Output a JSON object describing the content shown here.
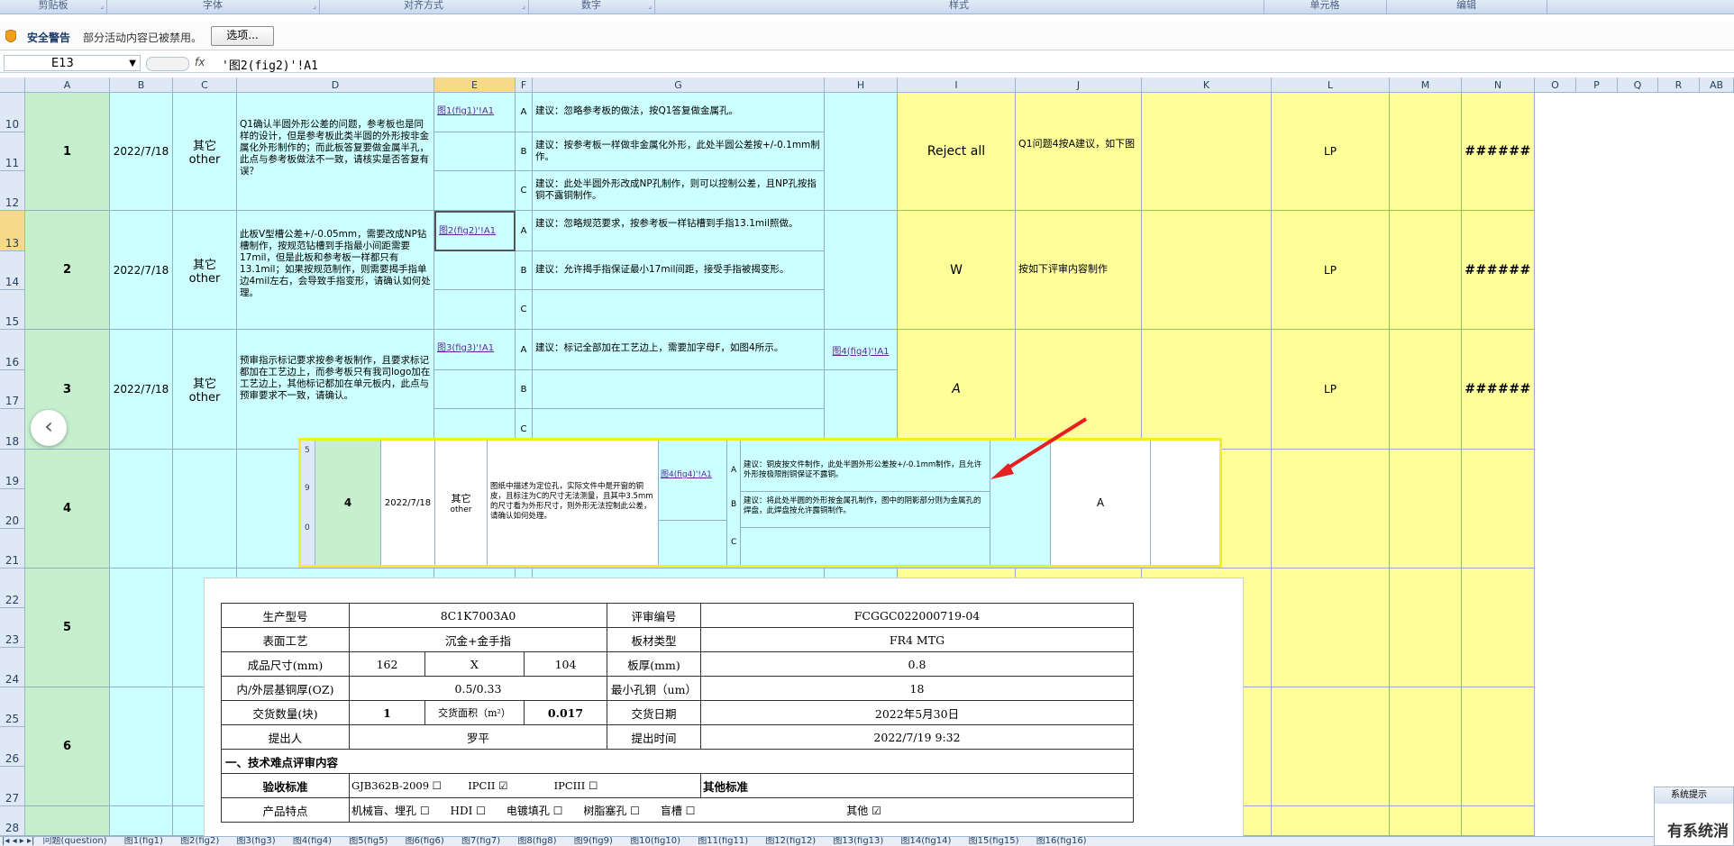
{
  "ribbon": {
    "groups": [
      "剪贴板",
      "字体",
      "对齐方式",
      "数字",
      "样式",
      "单元格",
      "编辑"
    ]
  },
  "security_bar": {
    "title": "安全警告",
    "message": "部分活动内容已被禁用。",
    "options_button": "选项..."
  },
  "formula_bar": {
    "name_box": "E13",
    "fx": "fx",
    "formula": "'图2(fig2)'!A1"
  },
  "columns": [
    "A",
    "B",
    "C",
    "D",
    "E",
    "F",
    "G",
    "H",
    "I",
    "J",
    "K",
    "L",
    "M",
    "N",
    "O",
    "P",
    "Q",
    "R",
    "AB"
  ],
  "rows": [
    "10",
    "11",
    "12",
    "13",
    "14",
    "15",
    "16",
    "17",
    "18",
    "19",
    "20",
    "21",
    "22",
    "23",
    "24",
    "25",
    "26",
    "27",
    "28"
  ],
  "records": [
    {
      "no": "1",
      "date": "2022/7/18",
      "type_cn": "其它",
      "type_en": "other",
      "question": "Q1确认半圆外形公差的问题，参考板也是同样的设计，但是参考板此类半圆的外形按非金属化外形制作的；而此板答复要做金属半孔，此点与参考板做法不一致，请核实是否答复有误？",
      "link": "图1(fig1)'!A1",
      "options": [
        {
          "letter": "A",
          "text": "建议：忽略参考板的做法，按Q1答复做金属孔。"
        },
        {
          "letter": "B",
          "text": "建议：按参考板一样做非金属化外形，此处半圆公差按+/-0.1mm制作。"
        },
        {
          "letter": "C",
          "text": "建议：此处半圆外形改成NP孔制作，则可以控制公差，且NP孔按指铜不露铜制作。"
        }
      ],
      "h_link": "",
      "decision": "Reject all",
      "comment": "Q1问题4按A建议，如下图",
      "owner": "LP",
      "n_value": "######"
    },
    {
      "no": "2",
      "date": "2022/7/18",
      "type_cn": "其它",
      "type_en": "other",
      "question": "此板V型槽公差+/-0.05mm，需要改成NP钻槽制作，按规范钻槽到手指最小间距需要17mil，但是此板和参考板一样都只有13.1mil；如果按规范制作，则需要揭手指单边4mil左右，会导致手指变形，请确认如何处理。",
      "link": "图2(fig2)'!A1",
      "options": [
        {
          "letter": "A",
          "text": "建议：忽略规范要求，按参考板一样钻槽到手指13.1mil照做。"
        },
        {
          "letter": "B",
          "text": "建议：允许揭手指保证最小17mil间距，接受手指被揭变形。"
        },
        {
          "letter": "C",
          "text": ""
        }
      ],
      "h_link": "",
      "decision": "W",
      "comment": "按如下评审内容制作",
      "owner": "LP",
      "n_value": "######"
    },
    {
      "no": "3",
      "date": "2022/7/18",
      "type_cn": "其它",
      "type_en": "other",
      "question": "预审指示标记要求按参考板制作，且要求标记都加在工艺边上，而参考板只有我司logo加在工艺边上，其他标记都加在单元板内，此点与预审要求不一致，请确认。",
      "link": "图3(fig3)'!A1",
      "options": [
        {
          "letter": "A",
          "text": "建议：标记全部加在工艺边上，需要加字母F，如图4所示。"
        },
        {
          "letter": "B",
          "text": ""
        },
        {
          "letter": "C",
          "text": ""
        }
      ],
      "h_link": "图4(fig4)'!A1",
      "decision": "A",
      "comment": "",
      "owner": "LP",
      "n_value": "######"
    },
    {
      "no": "4"
    },
    {
      "no": "5"
    },
    {
      "no": "6"
    }
  ],
  "overlay_row": {
    "no": "4",
    "date": "2022/7/18",
    "type_cn": "其它",
    "type_en": "other",
    "question": "图纸中描述为定位孔，实际文件中是开窗的铜皮，且标注为C的尺寸无法测量，且其中3.5mm的尺寸看为外形尺寸，则外形无法控制此公差，请确认如何处理。",
    "link": "图4(fig4)'!A1",
    "options": [
      {
        "letter": "A",
        "text": "建议：铜皮按文件制作，此处半圆外形公差按+/-0.1mm制作，且允许外形按极限削铜保证不露铜。"
      },
      {
        "letter": "B",
        "text": "建议：将此处半圆的外形按金属孔制作，图中的阴影部分则为金属孔的焊盘，此焊盘按允许露铜制作。"
      },
      {
        "letter": "C",
        "text": ""
      }
    ],
    "decision": "A",
    "row_marks": [
      "5",
      "9",
      "0"
    ]
  },
  "doc_table": {
    "r1": [
      "生产型号",
      "8C1K7003A0",
      "评审编号",
      "FCGGC022000719-04"
    ],
    "r2": [
      "表面工艺",
      "沉金+金手指",
      "板材类型",
      "FR4 MTG"
    ],
    "r3": [
      "成品尺寸(mm)",
      "162",
      "X",
      "104",
      "板厚(mm)",
      "0.8"
    ],
    "r4": [
      "内/外层基铜厚(OZ)",
      "0.5/0.33",
      "最小孔铜（um）",
      "18"
    ],
    "r5": [
      "交货数量(块)",
      "1",
      "交货面积（m²）",
      "0.017",
      "交货日期",
      "2022年5月30日"
    ],
    "r6": [
      "提出人",
      "罗平",
      "提出时间",
      "2022/7/19 9:32"
    ],
    "section": "一、技术难点评审内容",
    "r8": [
      "验收标准",
      "GJB362B-2009",
      "IPCII",
      "IPCIII",
      "其他标准"
    ],
    "r9": [
      "产品特点",
      "机械盲、埋孔",
      "HDI",
      "电镀填孔",
      "树脂塞孔",
      "盲槽",
      "其他"
    ]
  },
  "sheet_tabs": [
    "问题(question)",
    "图1(fig1)",
    "图2(fig2)",
    "图3(fig3)",
    "图4(fig4)",
    "图5(fig5)",
    "图6(fig6)",
    "图7(fig7)",
    "图8(fig8)",
    "图9(fig9)",
    "图10(fig10)",
    "图11(fig11)",
    "图12(fig12)",
    "图13(fig13)",
    "图14(fig14)",
    "图15(fig15)",
    "图16(fig16)"
  ],
  "system_prompt": {
    "title": "系统提示",
    "body": "有系统消"
  },
  "colors": {
    "green": "#c6efce",
    "cyan": "#ccffff",
    "yellow": "#ffff99",
    "arrow": "#e62020",
    "highlight": "#f0f020"
  }
}
